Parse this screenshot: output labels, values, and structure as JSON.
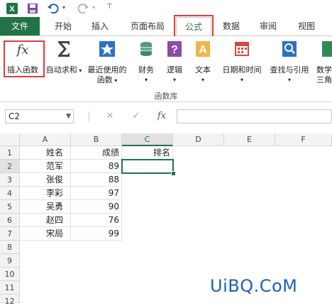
{
  "colors": {
    "accent": "#217346",
    "highlight": "#e23b3b",
    "watermark": "#1a62b5"
  },
  "tabs": [
    "文件",
    "开始",
    "插入",
    "页面布局",
    "公式",
    "数据",
    "审阅",
    "视图"
  ],
  "ribbon": {
    "buttons": [
      {
        "icon": "fx-icon",
        "label1": "插入函数",
        "label2": ""
      },
      {
        "icon": "sigma-icon",
        "label1": "自动求和",
        "label2": ""
      },
      {
        "icon": "star-icon",
        "label1": "最近使用的",
        "label2": "函数"
      },
      {
        "icon": "finance-icon",
        "label1": "财务",
        "label2": ""
      },
      {
        "icon": "logic-icon",
        "label1": "逻辑",
        "label2": ""
      },
      {
        "icon": "text-icon",
        "label1": "文本",
        "label2": ""
      },
      {
        "icon": "datetime-icon",
        "label1": "日期和时间",
        "label2": ""
      },
      {
        "icon": "lookup-icon",
        "label1": "查找与引用",
        "label2": ""
      },
      {
        "icon": "math-icon",
        "label1": "数学",
        "label2": "三角函"
      }
    ],
    "group_label": "函数库"
  },
  "formula_bar": {
    "name_box": "C2",
    "fx_label": "fx",
    "value": ""
  },
  "sheet": {
    "columns": [
      "A",
      "B",
      "C",
      "D",
      "E",
      "F"
    ],
    "rows": [
      "1",
      "2",
      "3",
      "4",
      "5",
      "6",
      "7",
      "8",
      "9",
      "10",
      "11",
      "12"
    ],
    "header_row": {
      "name": "姓名",
      "score": "成绩",
      "rank": "排名"
    },
    "data": [
      {
        "name": "范军",
        "score": "89"
      },
      {
        "name": "张俊",
        "score": "88"
      },
      {
        "name": "李彩",
        "score": "97"
      },
      {
        "name": "吴勇",
        "score": "90"
      },
      {
        "name": "赵四",
        "score": "76"
      },
      {
        "name": "宋局",
        "score": "99"
      }
    ],
    "selected_cell": "C2"
  },
  "watermark": "UiBQ.CoM"
}
